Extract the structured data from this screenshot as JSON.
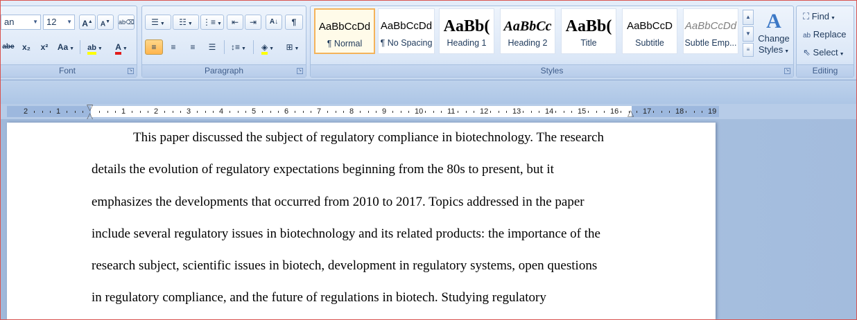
{
  "font": {
    "font_name": "an",
    "font_size": "12",
    "grow_icon": "A",
    "shrink_icon": "A",
    "strikethrough": "abe",
    "subscript": "x₂",
    "superscript": "x²",
    "change_case": "Aa",
    "highlight": "ab",
    "font_color": "A",
    "label": "Font"
  },
  "paragraph": {
    "label": "Paragraph",
    "show_marks": "¶"
  },
  "styles": {
    "label": "Styles",
    "items": [
      {
        "sample": "AaBbCcDd",
        "name": "¶ Normal"
      },
      {
        "sample": "AaBbCcDd",
        "name": "¶ No Spacing"
      },
      {
        "sample": "AaBb(",
        "name": "Heading 1"
      },
      {
        "sample": "AaBbCc",
        "name": "Heading 2"
      },
      {
        "sample": "AaBb(",
        "name": "Title"
      },
      {
        "sample": "AaBbCcD",
        "name": "Subtitle"
      },
      {
        "sample": "AaBbCcDd",
        "name": "Subtle Emp..."
      }
    ],
    "change_styles_line1": "Change",
    "change_styles_line2": "Styles"
  },
  "editing": {
    "label": "Editing",
    "find": "Find",
    "replace": "Replace",
    "select": "Select"
  },
  "ruler": {
    "left_numbers": [
      "2",
      "1"
    ],
    "right_numbers": [
      "1",
      "2",
      "3",
      "4",
      "5",
      "6",
      "7",
      "8",
      "9",
      "10",
      "11",
      "12",
      "13",
      "14",
      "15",
      "16",
      "17",
      "18",
      "19"
    ]
  },
  "document": {
    "lines": [
      "This paper discussed the subject of regulatory compliance in biotechnology. The research",
      "details the evolution of regulatory expectations beginning from the 80s to present, but it",
      "emphasizes the developments that occurred from 2010 to 2017. Topics addressed in the paper",
      "include several regulatory issues in biotechnology and its related products: the importance of the",
      "research subject, scientific issues in biotech, development in regulatory systems, open questions",
      "in regulatory compliance, and the future of regulations in biotech. Studying regulatory"
    ]
  }
}
